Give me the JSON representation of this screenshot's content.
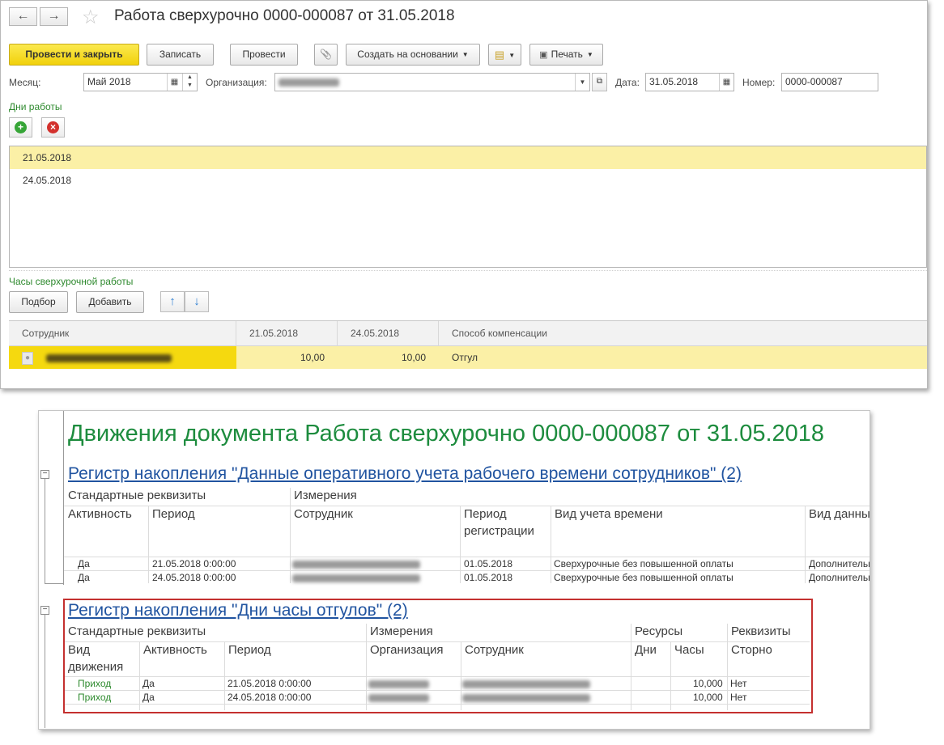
{
  "window": {
    "title": "Работа сверхурочно 0000-000087 от 31.05.2018",
    "back_icon": "←",
    "forward_icon": "→",
    "star_icon": "☆"
  },
  "toolbar": {
    "post_close": "Провести и закрыть",
    "save": "Записать",
    "post": "Провести",
    "attach_icon": "📎",
    "create_based": "Создать на основании",
    "report_icon": "▤",
    "print": "Печать"
  },
  "fields": {
    "month_label": "Месяц:",
    "month_value": "Май 2018",
    "org_label": "Организация:",
    "date_label": "Дата:",
    "date_value": "31.05.2018",
    "number_label": "Номер:",
    "number_value": "0000-000087"
  },
  "days": {
    "section_label": "Дни работы",
    "add_icon": "+",
    "remove_icon": "×",
    "rows": [
      "21.05.2018",
      "24.05.2018"
    ]
  },
  "overtime": {
    "section_label": "Часы сверхурочной работы",
    "pick_button": "Подбор",
    "add_button": "Добавить",
    "up_icon": "↑",
    "down_icon": "↓",
    "headers": [
      "Сотрудник",
      "21.05.2018",
      "24.05.2018",
      "Способ компенсации"
    ],
    "row": {
      "h1": "10,00",
      "h2": "10,00",
      "comp": "Отгул"
    }
  },
  "report": {
    "title": "Движения документа Работа сверхурочно 0000-000087 от 31.05.2018",
    "reg1": {
      "title": "Регистр накопления \"Данные оперативного учета рабочего времени сотрудников\" (2)",
      "group_std": "Стандартные реквизиты",
      "group_dims": "Измерения",
      "col_active": "Активность",
      "col_period": "Период",
      "col_employee": "Сотрудник",
      "col_reg_period_1": "Период",
      "col_reg_period_2": "регистрации",
      "col_time_kind": "Вид учета времени",
      "col_data_kind": "Вид данных",
      "rows": [
        {
          "active": "Да",
          "period": "21.05.2018 0:00:00",
          "reg_period": "01.05.2018",
          "time_kind": "Сверхурочные без повышенной оплаты",
          "data_kind": "Дополнительно"
        },
        {
          "active": "Да",
          "period": "24.05.2018 0:00:00",
          "reg_period": "01.05.2018",
          "time_kind": "Сверхурочные без повышенной оплаты",
          "data_kind": "Дополнительно"
        }
      ]
    },
    "reg2": {
      "title": "Регистр накопления \"Дни часы отгулов\" (2)",
      "group_std": "Стандартные реквизиты",
      "group_dims": "Измерения",
      "group_res": "Ресурсы",
      "group_req": "Реквизиты",
      "col_move_1": "Вид",
      "col_move_2": "движения",
      "col_active": "Активность",
      "col_period": "Период",
      "col_org": "Организация",
      "col_employee": "Сотрудник",
      "col_days": "Дни",
      "col_hours": "Часы",
      "col_storno": "Сторно",
      "rows": [
        {
          "move": "Приход",
          "active": "Да",
          "period": "21.05.2018 0:00:00",
          "hours": "10,000",
          "storno": "Нет"
        },
        {
          "move": "Приход",
          "active": "Да",
          "period": "24.05.2018 0:00:00",
          "hours": "10,000",
          "storno": "Нет"
        }
      ]
    }
  }
}
